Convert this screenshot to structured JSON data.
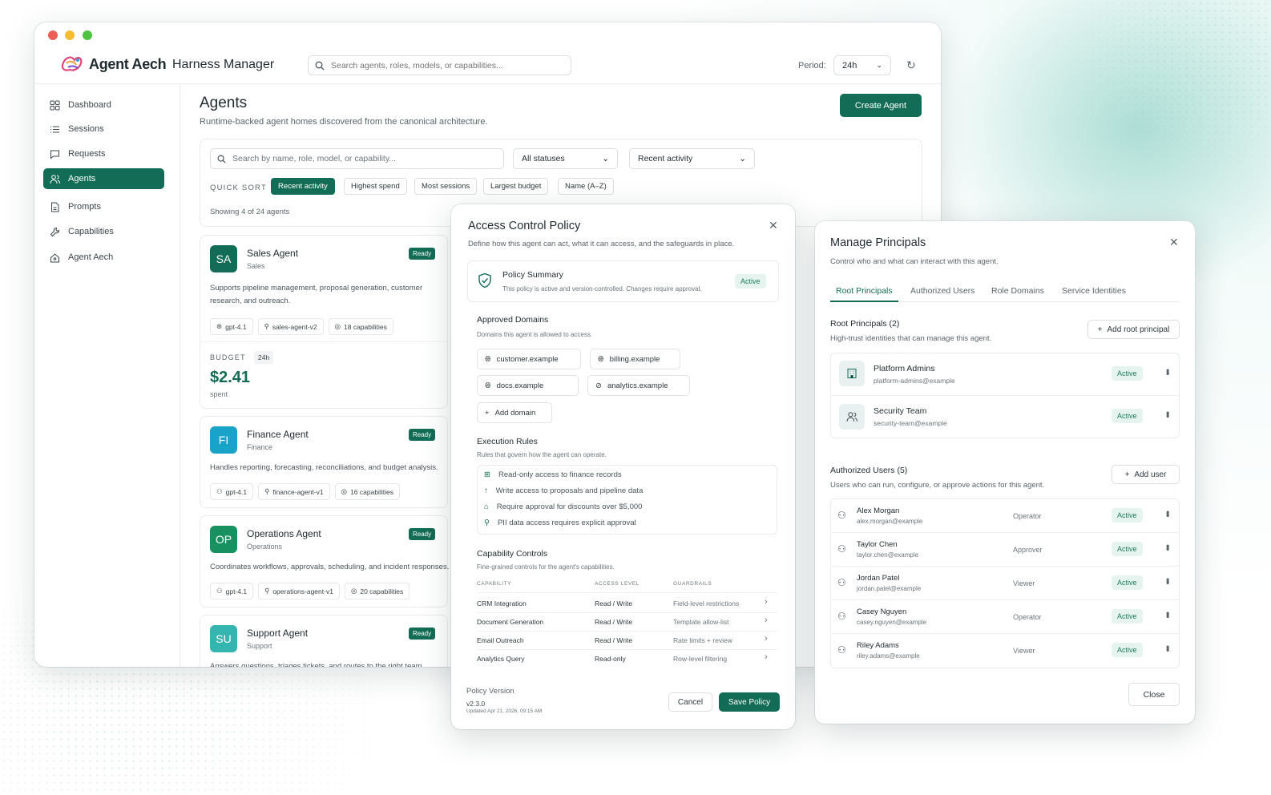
{
  "app": {
    "brand": "Agent Aech",
    "title": "Harness Manager",
    "search_placeholder": "Search agents, roles, models, or capabilities...",
    "period_label": "Period:",
    "period_value": "24h"
  },
  "sidebar": {
    "items": [
      {
        "label": "Dashboard",
        "icon": "grid-icon"
      },
      {
        "label": "Sessions",
        "icon": "list-icon"
      },
      {
        "label": "Requests",
        "icon": "chat-icon"
      },
      {
        "label": "Agents",
        "icon": "users-icon",
        "active": true
      },
      {
        "label": "Prompts",
        "icon": "document-icon"
      },
      {
        "label": "Capabilities",
        "icon": "wrench-icon"
      },
      {
        "label": "Agent Aech",
        "icon": "home-icon"
      }
    ]
  },
  "page": {
    "title": "Agents",
    "subtitle": "Runtime-backed agent homes discovered from the canonical architecture.",
    "create_label": "Create Agent"
  },
  "filters": {
    "search_placeholder": "Search by name, role, model, or capability...",
    "status": "All statuses",
    "sort": "Recent activity",
    "quick_sort_label": "QUICK SORT",
    "chips": [
      "Recent activity",
      "Highest spend",
      "Most sessions",
      "Largest budget",
      "Name (A–Z)"
    ],
    "showing": "Showing 4 of 24 agents"
  },
  "agents": [
    {
      "initials": "SA",
      "name": "Sales Agent",
      "role": "Sales",
      "status": "Ready",
      "desc": "Supports pipeline management, proposal generation, customer research, and outreach.",
      "model": "gpt-4.1",
      "slug": "sales-agent-v2",
      "caps": "18 capabilities",
      "budget_label": "BUDGET",
      "budget_period": "24h",
      "spend": "$2.41",
      "spent_label": "spent",
      "color": "#136c55"
    },
    {
      "initials": "FI",
      "name": "Finance Agent",
      "role": "Finance",
      "status": "Ready",
      "desc": "Handles reporting, forecasting, reconciliations, and budget analysis.",
      "model": "gpt-4.1",
      "slug": "finance-agent-v1",
      "caps": "16 capabilities",
      "color": "#1aa3c8"
    },
    {
      "initials": "OP",
      "name": "Operations Agent",
      "role": "Operations",
      "status": "Ready",
      "desc": "Coordinates workflows, approvals, scheduling, and incident responses.",
      "model": "gpt-4.1",
      "slug": "operations-agent-v1",
      "caps": "20 capabilities",
      "color": "#17915f"
    },
    {
      "initials": "SU",
      "name": "Support Agent",
      "role": "Support",
      "status": "Ready",
      "desc": "Answers questions, triages tickets, and routes to the right team.",
      "color": "#35b5b0"
    }
  ],
  "policy": {
    "title": "Access Control Policy",
    "subtitle": "Define how this agent can act, what it can access, and the safeguards in place.",
    "summary_title": "Policy Summary",
    "summary_text": "This policy is active and version-controlled. Changes require approval.",
    "summary_status": "Active",
    "domains_title": "Approved Domains",
    "domains_sub": "Domains this agent is allowed to access.",
    "domains": [
      "customer.example",
      "billing.example",
      "docs.example",
      "analytics.example"
    ],
    "add_domain": "Add domain",
    "rules_title": "Execution Rules",
    "rules_sub": "Rules that govern how the agent can operate.",
    "rules": [
      "Read-only access to finance records",
      "Write access to proposals and pipeline data",
      "Require approval for discounts over $5,000",
      "PII data access requires explicit approval"
    ],
    "caps_title": "Capability Controls",
    "caps_sub": "Fine-grained controls for the agent's capabilities.",
    "cols": [
      "CAPABILITY",
      "ACCESS LEVEL",
      "GUARDRAILS"
    ],
    "rows": [
      [
        "CRM Integration",
        "Read / Write",
        "Field-level restrictions"
      ],
      [
        "Document Generation",
        "Read / Write",
        "Template allow-list"
      ],
      [
        "Email Outreach",
        "Read / Write",
        "Rate limits + review"
      ],
      [
        "Analytics Query",
        "Read-only",
        "Row-level filtering"
      ]
    ],
    "version_label": "Policy Version",
    "version": "v2.3.0",
    "updated": "Updated Apr 21, 2026, 09:15 AM",
    "cancel": "Cancel",
    "save": "Save Policy"
  },
  "principals": {
    "title": "Manage Principals",
    "subtitle": "Control who and what can interact with this agent.",
    "tabs": [
      "Root Principals",
      "Authorized Users",
      "Role Domains",
      "Service Identities"
    ],
    "root_title": "Root Principals (2)",
    "root_sub": "High-trust identities that can manage this agent.",
    "add_root": "Add root principal",
    "roots": [
      {
        "name": "Platform Admins",
        "email": "platform-admins@example",
        "status": "Active"
      },
      {
        "name": "Security Team",
        "email": "security-team@example",
        "status": "Active"
      }
    ],
    "users_title": "Authorized Users (5)",
    "users_sub": "Users who can run, configure, or approve actions for this agent.",
    "add_user": "Add user",
    "users": [
      {
        "name": "Alex Morgan",
        "email": "alex.morgan@example",
        "role": "Operator",
        "status": "Active"
      },
      {
        "name": "Taylor Chen",
        "email": "taylor.chen@example",
        "role": "Approver",
        "status": "Active"
      },
      {
        "name": "Jordan Patel",
        "email": "jordan.patel@example",
        "role": "Viewer",
        "status": "Active"
      },
      {
        "name": "Casey Nguyen",
        "email": "casey.nguyen@example",
        "role": "Operator",
        "status": "Active"
      },
      {
        "name": "Riley Adams",
        "email": "riley.adams@example",
        "role": "Viewer",
        "status": "Active"
      }
    ],
    "close": "Close"
  }
}
